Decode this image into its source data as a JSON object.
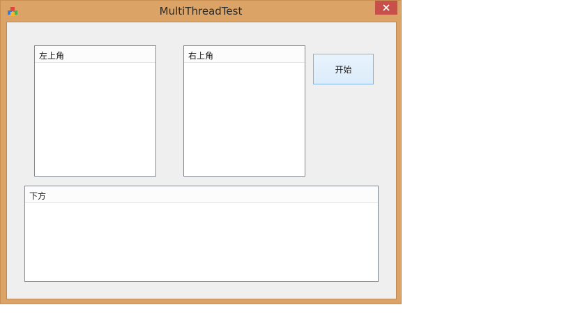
{
  "window": {
    "title": "MultiThreadTest",
    "app_icon": "app-icon",
    "close_icon": "close-icon",
    "frame_color": "#dba466",
    "close_color": "#c7504b"
  },
  "lists": {
    "top_left": {
      "header": "左上角"
    },
    "top_right": {
      "header": "右上角"
    },
    "bottom": {
      "header": "下方"
    }
  },
  "buttons": {
    "start_label": "开始"
  }
}
